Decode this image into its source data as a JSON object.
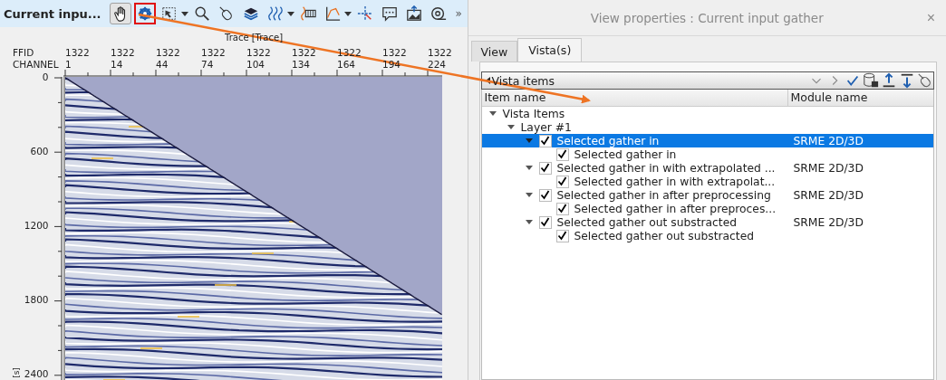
{
  "viewer": {
    "title": "Current inpu...",
    "tools": [
      {
        "selected": true,
        "highlighted": false,
        "dropdown": false
      },
      {
        "selected": false,
        "highlighted": true,
        "dropdown": false
      },
      {
        "selected": false,
        "highlighted": false,
        "dropdown": true
      },
      {
        "selected": false,
        "highlighted": false,
        "dropdown": false
      },
      {
        "selected": false,
        "highlighted": false,
        "dropdown": false
      },
      {
        "selected": false,
        "highlighted": false,
        "dropdown": false
      },
      {
        "selected": false,
        "highlighted": false,
        "dropdown": true
      },
      {
        "selected": false,
        "highlighted": false,
        "dropdown": false
      },
      {
        "selected": false,
        "highlighted": false,
        "dropdown": true
      },
      {
        "selected": false,
        "highlighted": false,
        "dropdown": false
      },
      {
        "selected": false,
        "highlighted": false,
        "dropdown": false
      },
      {
        "selected": false,
        "highlighted": false,
        "dropdown": false
      },
      {
        "selected": false,
        "highlighted": false,
        "dropdown": false
      }
    ],
    "overflow": "»",
    "x_axis_title": "Trace [Trace]",
    "header_labels": [
      "FFID",
      "CHANNEL"
    ],
    "x_ticks": [
      {
        "ffid": "1322",
        "channel": "1"
      },
      {
        "ffid": "1322",
        "channel": "14"
      },
      {
        "ffid": "1322",
        "channel": "44"
      },
      {
        "ffid": "1322",
        "channel": "74"
      },
      {
        "ffid": "1322",
        "channel": "104"
      },
      {
        "ffid": "1322",
        "channel": "134"
      },
      {
        "ffid": "1322",
        "channel": "164"
      },
      {
        "ffid": "1322",
        "channel": "194"
      },
      {
        "ffid": "1322",
        "channel": "224"
      }
    ],
    "y_ticks": [
      "0",
      "600",
      "1200",
      "1800",
      "2400"
    ],
    "y_axis_unit": "[s]"
  },
  "dialog": {
    "title": "View properties : Current input gather",
    "close": "×",
    "tabs": [
      {
        "label": "View",
        "selected": false
      },
      {
        "label": "Vista(s)",
        "selected": true
      }
    ],
    "panel_title": "Vista items",
    "columns": [
      "Item name",
      "Module name"
    ],
    "tree": [
      {
        "label": "Vista Items",
        "expanded": true,
        "selected": false,
        "children": [
          {
            "label": "Layer  #1",
            "expanded": true,
            "selected": false,
            "children": [
              {
                "label": "Selected gather in",
                "module": "SRME 2D/3D",
                "checked": true,
                "expanded": true,
                "selected": true,
                "children": [
                  {
                    "label": "Selected gather in",
                    "checked": true,
                    "selected": false
                  }
                ]
              },
              {
                "label": "Selected gather in with extrapolated ...",
                "module": "SRME 2D/3D",
                "checked": true,
                "expanded": true,
                "selected": false,
                "children": [
                  {
                    "label": "Selected gather in with extrapolat...",
                    "checked": true,
                    "selected": false
                  }
                ]
              },
              {
                "label": "Selected gather in after preprocessing",
                "module": "SRME 2D/3D",
                "checked": true,
                "expanded": true,
                "selected": false,
                "children": [
                  {
                    "label": "Selected gather in after preproces...",
                    "checked": true,
                    "selected": false
                  }
                ]
              },
              {
                "label": "Selected gather out substracted",
                "module": "SRME 2D/3D",
                "checked": true,
                "expanded": true,
                "selected": false,
                "children": [
                  {
                    "label": "Selected gather out substracted",
                    "checked": true,
                    "selected": false
                  }
                ]
              }
            ]
          }
        ]
      }
    ]
  }
}
